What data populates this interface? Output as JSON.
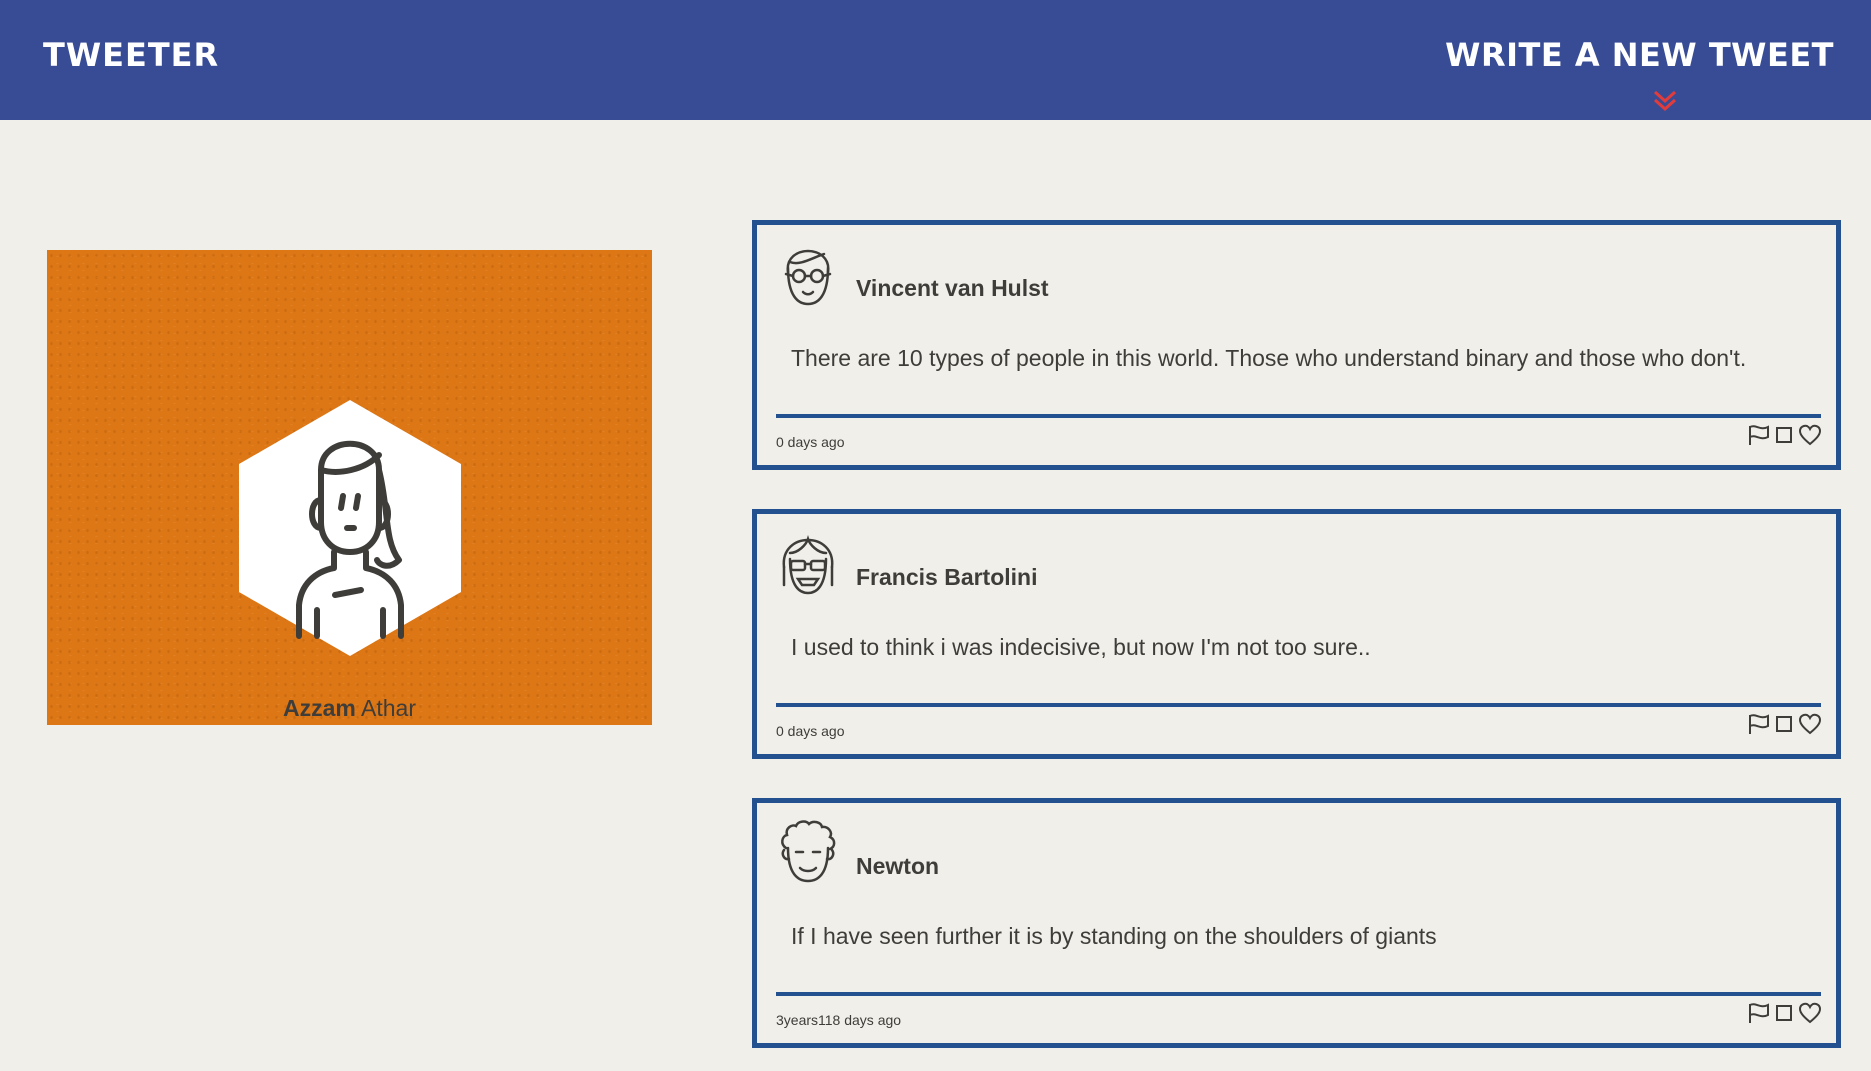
{
  "header": {
    "brand": "TWEETER",
    "compose_label": "WRITE A NEW TWEET",
    "compose_icon": "double-chevron-down-icon",
    "accent": "#e23b3b",
    "background": "#384c96"
  },
  "profile": {
    "first_name": "Azzam",
    "last_name": "Athar",
    "card_color": "#dd7615",
    "avatar_icon": "woman-avatar-icon"
  },
  "tweets": [
    {
      "author": "Vincent van Hulst",
      "avatar_icon": "glasses-man-avatar-icon",
      "text": "There are 10 types of people in this world. Those who understand binary and those who don't.",
      "age": "0 days ago"
    },
    {
      "author": "Francis Bartolini",
      "avatar_icon": "sunglasses-woman-avatar-icon",
      "text": "I used to think i was indecisive, but now I'm not too sure..",
      "age": "0 days ago"
    },
    {
      "author": "Newton",
      "avatar_icon": "curly-hair-man-avatar-icon",
      "text": "If I have seen further it is by standing on the shoulders of giants",
      "age": "3years118 days ago"
    }
  ],
  "tweet_actions": [
    "flag-icon",
    "retweet-icon",
    "heart-icon"
  ],
  "colors": {
    "tweet_border": "#23508f",
    "page_background": "#f1efe9"
  }
}
